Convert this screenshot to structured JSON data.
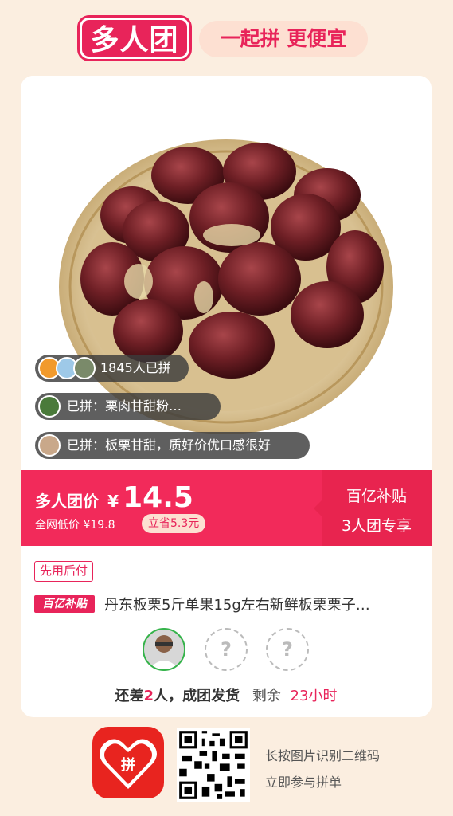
{
  "header": {
    "title": "多人团",
    "slogan": "一起拼 更便宜"
  },
  "social": {
    "joined_count": "1845人已拼",
    "review_1": "已拼：栗肉甘甜粉…",
    "review_2": "已拼：板栗甘甜，质好价优口感很好"
  },
  "price": {
    "label": "多人团价",
    "currency": "¥",
    "value": "14.5",
    "original": "全网低价 ¥19.8",
    "saving": "立省5.3元",
    "subsidy_line1": "百亿补贴",
    "subsidy_line2": "3人团专享"
  },
  "product": {
    "pay_tag": "先用后付",
    "subsidy_tag": "百亿补贴",
    "title": "丹东板栗5斤单果15g左右新鲜板栗栗子…"
  },
  "group": {
    "empty_slot": "?",
    "status_prefix": "还差",
    "missing_count": "2",
    "status_middle": "人，成团发货",
    "remaining_label": "剩余",
    "remaining_time": "23小时"
  },
  "footer": {
    "app_icon_text": "拼",
    "hint_line1": "长按图片识别二维码",
    "hint_line2": "立即参与拼单"
  },
  "colors": {
    "accent": "#e8245a",
    "price_bar": "#f22a5a",
    "background": "#fbeee0"
  }
}
